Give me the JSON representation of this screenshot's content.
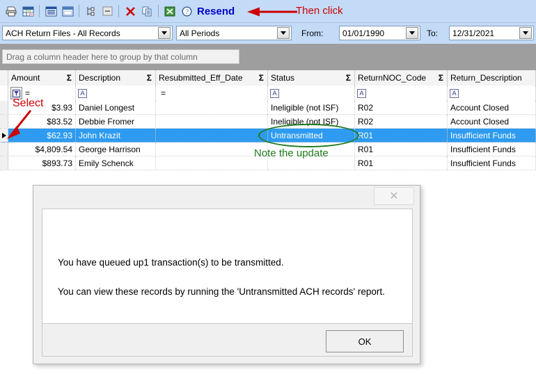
{
  "toolbar": {
    "icons": [
      {
        "name": "print-icon",
        "glyph": "print"
      },
      {
        "name": "grid-table-icon",
        "glyph": "table"
      },
      {
        "name": "report-view-icon",
        "glyph": "report"
      },
      {
        "name": "window-view-icon",
        "glyph": "window"
      },
      {
        "name": "tree-outline-icon",
        "glyph": "tree"
      },
      {
        "name": "collapse-icon",
        "glyph": "collapse"
      },
      {
        "name": "delete-icon",
        "glyph": "x-red"
      },
      {
        "name": "copy-icon",
        "glyph": "copy"
      },
      {
        "name": "export-excel-icon",
        "glyph": "excel"
      },
      {
        "name": "help-icon",
        "glyph": "help"
      }
    ],
    "resend_label": "Resend",
    "annotation_then_click": "Then click"
  },
  "filter_bar": {
    "view_select": "ACH Return Files - All Records",
    "period_select": "All Periods",
    "from_label": "From:",
    "from_date": "01/01/1990",
    "to_label": "To:",
    "to_date": "12/31/2021"
  },
  "group_panel": {
    "hint": "Drag a column header here to group by that column"
  },
  "grid": {
    "columns": [
      {
        "key": "amount",
        "label": "Amount",
        "sigma": "Σ",
        "filter_op": "=",
        "filter_icon": "filter-funnel-icon"
      },
      {
        "key": "description",
        "label": "Description",
        "sigma": "Σ",
        "filter_op": "",
        "filter_icon": "text-filter-icon"
      },
      {
        "key": "resubmitted_eff_date",
        "label": "Resubmitted_Eff_Date",
        "sigma": "Σ",
        "filter_op": "=",
        "filter_icon": ""
      },
      {
        "key": "status",
        "label": "Status",
        "sigma": "Σ",
        "filter_op": "",
        "filter_icon": "text-filter-icon"
      },
      {
        "key": "return_noc_code",
        "label": "ReturnNOC_Code",
        "sigma": "Σ",
        "filter_op": "",
        "filter_icon": "text-filter-icon"
      },
      {
        "key": "return_description",
        "label": "Return_Description",
        "sigma": "",
        "filter_op": "",
        "filter_icon": "text-filter-icon"
      }
    ],
    "rows": [
      {
        "amount": "$3.93",
        "description": "Daniel Longest",
        "resubmitted_eff_date": "",
        "status": "Ineligible (not ISF)",
        "return_noc_code": "R02",
        "return_description": "Account Closed",
        "selected": false
      },
      {
        "amount": "$83.52",
        "description": "Debbie Fromer",
        "resubmitted_eff_date": "",
        "status": "Ineligible (not ISF)",
        "return_noc_code": "R02",
        "return_description": "Account Closed",
        "selected": false
      },
      {
        "amount": "$62.93",
        "description": "John Krazit",
        "resubmitted_eff_date": "",
        "status": "Untransmitted",
        "return_noc_code": "R01",
        "return_description": "Insufficient Funds",
        "selected": true
      },
      {
        "amount": "$4,809.54",
        "description": "George Harrison",
        "resubmitted_eff_date": "",
        "status": "",
        "return_noc_code": "R01",
        "return_description": "Insufficient Funds",
        "selected": false
      },
      {
        "amount": "$893.73",
        "description": "Emily Schenck",
        "resubmitted_eff_date": "",
        "status": "",
        "return_noc_code": "R01",
        "return_description": "Insufficient Funds",
        "selected": false
      }
    ]
  },
  "annotations": {
    "select": "Select",
    "note_update": "Note the update"
  },
  "dialog": {
    "close_glyph": "✕",
    "line1": "You have queued up1 transaction(s) to be transmitted.",
    "line2": "You can view these records by running the 'Untransmitted ACH records' report.",
    "ok_label": "OK"
  },
  "colors": {
    "toolbar_bg": "#c3dbf7",
    "selection_blue": "#2e9bf0",
    "annotation_red": "#cc0000",
    "annotation_green": "#1f7a1f",
    "resend_blue": "#0000cc",
    "group_panel_gray": "#9e9e9e"
  }
}
